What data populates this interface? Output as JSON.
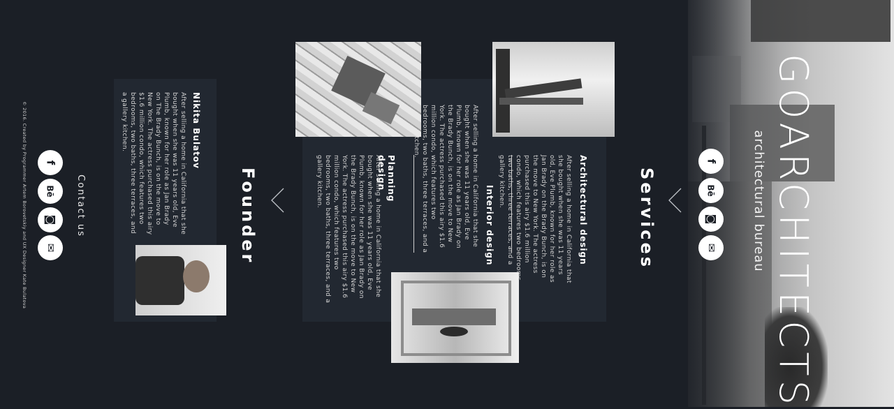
{
  "brand": {
    "title": "GOARCHITECTS",
    "subtitle": "architectural bureau"
  },
  "nav": {
    "services_title": "Services",
    "founder_title": "Founder"
  },
  "social": [
    {
      "name": "facebook",
      "glyph": "f"
    },
    {
      "name": "behance",
      "glyph": "Bē"
    },
    {
      "name": "instagram",
      "glyph": "◙"
    },
    {
      "name": "email",
      "glyph": "✉"
    }
  ],
  "services": [
    {
      "title": "Architectural design",
      "text": "After selling a home in California that she bought when she was 11 years old, Eve Plumb, known for her role as Jan Brady on the Brady Bunch, is on the move to New York. The actress purchased this airy $1.6 million condo, which features two bedrooms, two baths, three terraces, and a gallery kitchen."
    },
    {
      "title": "Interior design",
      "text": "After selling a home in California that she bought when she was 11 years old, Eve Plumb, known for her role as Jan Brady on the Brady Bunch, is on the move to New York. The actress purchased this airy $1.6 million condo, which features two bedrooms, two baths, three terraces, and a gallery kitchen."
    },
    {
      "title": "Planning design",
      "text": "After selling a home in California that she bought when she was 11 years old, Eve Plumb, known for her role as Jan Brady on the Brady Bunch, is on the move to New York. The actress purchased this airy $1.6 million condo, which features two bedrooms, two baths, three terraces, and a gallery kitchen."
    }
  ],
  "founder": {
    "name": "Nikita Bulatov",
    "bio": "After selling a home in California that she bought when she was 11 years old, Eve Plumb, known for her role as Jan Brady on The Brady Bunch, is on the move to New York. The actress purchased this airy $1.6 million condo, which features two bedrooms, two baths, three terraces, and a gallery kitchen."
  },
  "contact": {
    "label": "Contact us"
  },
  "footer": {
    "copyright": "© 2016. Created by Programmer Artem Borovetskiy and UX Designer Kate Bulatova"
  }
}
